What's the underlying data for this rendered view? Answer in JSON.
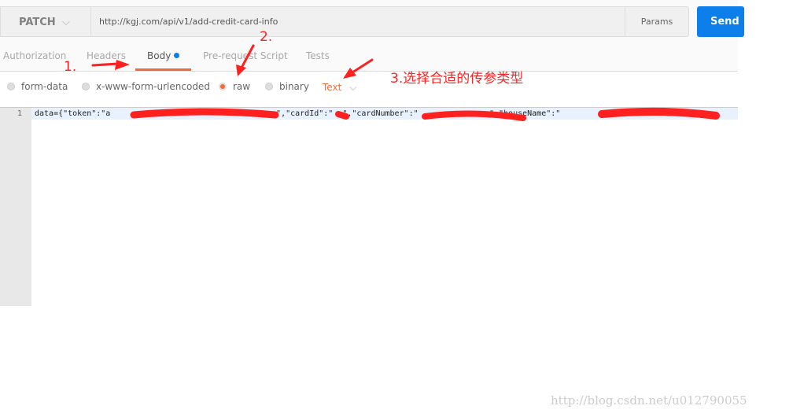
{
  "request": {
    "method": "PATCH",
    "url": "http://kgj.com/api/v1/add-credit-card-info",
    "params_label": "Params",
    "send_label": "Send"
  },
  "tabs": [
    {
      "label": "Authorization"
    },
    {
      "label": "Headers"
    },
    {
      "label": "Body",
      "active": true
    },
    {
      "label": "Pre-request Script"
    },
    {
      "label": "Tests"
    }
  ],
  "body_types": [
    {
      "label": "form-data"
    },
    {
      "label": "x-www-form-urlencoded"
    },
    {
      "label": "raw",
      "selected": true
    },
    {
      "label": "binary"
    }
  ],
  "raw_type": "Text",
  "editor": {
    "line_number": "1",
    "content": "data={\"token\":\"a                                   ",
    "content2": "\",\"cardId\":\"  \",\"cardNumber\":\"               \",\"houseName\":\"                  \""
  },
  "annotations": {
    "step1": "1.",
    "step2": "2.",
    "step3": "3.选择合适的传参类型"
  },
  "watermark": "http://blog.csdn.net/u012790055",
  "colors": {
    "accent": "#f26b3a",
    "send": "#0d7fea",
    "annotation": "#ff2222"
  }
}
